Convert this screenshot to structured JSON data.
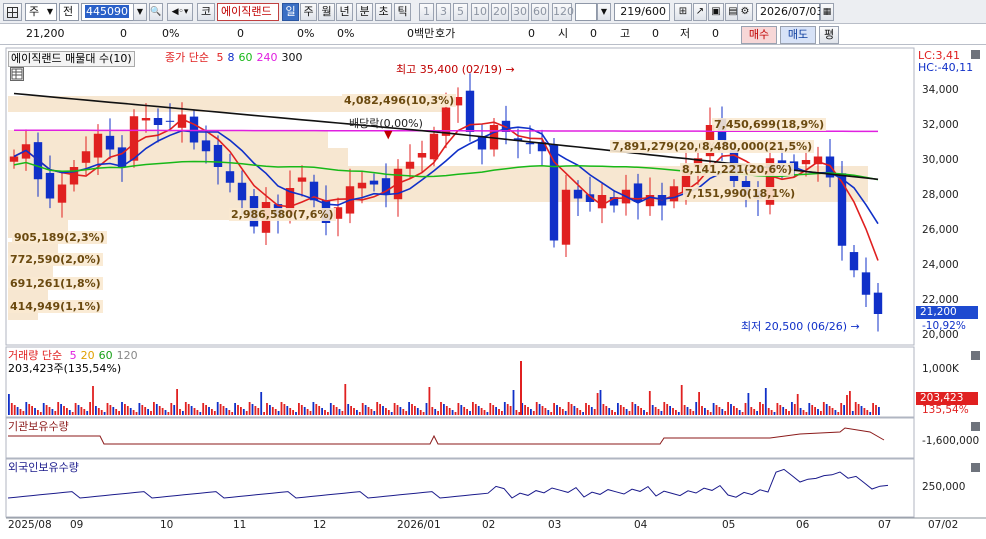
{
  "toolbar": {
    "view_icon": "grid-icon",
    "market": "주",
    "period_mode": "전",
    "code": "445090",
    "sound_icon": "speaker-icon",
    "name_prefix": "코",
    "stock_name": "에이직랜드",
    "periods": [
      "일",
      "주",
      "월",
      "년",
      "분",
      "초",
      "틱"
    ],
    "active_period": "일",
    "nums": [
      "1",
      "3",
      "5",
      "10",
      "20",
      "30",
      "60",
      "120"
    ],
    "count": "219",
    "total": "600",
    "date": "2026/07/03"
  },
  "quote": {
    "price": "21,200",
    "v1": "0",
    "v2": "0",
    "p1": "0%",
    "v3": "0",
    "p2": "0%",
    "v4": "0",
    "p3": "0%",
    "unit_label": "0백만",
    "hoga_label": "호가",
    "hoga": "0",
    "open_label": "시",
    "open": "0",
    "high_label": "고",
    "high": "0",
    "low_label": "저",
    "low": "0",
    "buy": "매수",
    "sell": "매도",
    "avg": "평"
  },
  "price_panel": {
    "title": "에이직랜드 매물대 수(10)",
    "ma_label": "종가 단순",
    "ma_periods": [
      {
        "p": "5",
        "color": "#e02020"
      },
      {
        "p": "8",
        "color": "#1030c8"
      },
      {
        "p": "60",
        "color": "#18b818"
      },
      {
        "p": "240",
        "color": "#e020e0"
      },
      {
        "p": "300",
        "color": "#111111"
      }
    ],
    "lc": "LC:3,41",
    "hc": "HC:-40,11",
    "y_ticks": [
      "34,000",
      "32,000",
      "30,000",
      "28,000",
      "26,000",
      "24,000",
      "22,000",
      "20,000"
    ],
    "current_price": "21,200",
    "current_change": "-10,92%",
    "high_annot": "최고 35,400 (02/19)",
    "low_annot": "최저 20,500 (06/26)",
    "dividend": "배당락(0,00%)",
    "volume_profile_labels": [
      "4,082,496(10,3%)",
      "2,986,580(7,6%)",
      "7,450,699(18,9%)",
      "7,891,279(20,0%)",
      "8,480,000(21,5%)",
      "7,151,990(18,1%)",
      "8,141,221(20,6%)",
      "905,189(2,3%)",
      "772,590(2,0%)",
      "691,261(1,8%)",
      "414,949(1,1%)"
    ]
  },
  "volume_panel": {
    "title": "거래량",
    "ma_label": "단순",
    "ma_periods": [
      {
        "p": "5",
        "color": "#e020e0"
      },
      {
        "p": "20",
        "color": "#e0a000"
      },
      {
        "p": "60",
        "color": "#18a018"
      },
      {
        "p": "120",
        "color": "#888888"
      }
    ],
    "value_text": "203,423주(135,54%)",
    "y_tick": "1,000K",
    "current": "203,423",
    "current_pct": "135,54%"
  },
  "inst_panel": {
    "title": "기관보유수량",
    "y_tick": "-1,600,000"
  },
  "foreign_panel": {
    "title": "외국인보유수량",
    "y_tick": "250,000"
  },
  "x_axis": [
    "2025/08",
    "09",
    "10",
    "11",
    "12",
    "2026/01",
    "02",
    "03",
    "04",
    "05",
    "06",
    "07",
    "07/02"
  ],
  "chart_data": {
    "type": "candlestick",
    "title": "에이직랜드",
    "series": [
      {
        "name": "종가",
        "values": [
          30200,
          30900,
          28900,
          27800,
          28600,
          29600,
          30500,
          31500,
          30600,
          29600,
          32500,
          32400,
          32000,
          32200,
          32600,
          31000,
          30500,
          29600,
          28700,
          27700,
          26200,
          27600,
          26800,
          28400,
          29000,
          27700,
          26400,
          27300,
          28500,
          28700,
          28600,
          28000,
          29500,
          29900,
          30400,
          31500,
          33000,
          33600,
          31600,
          30600,
          32000,
          31600,
          31100,
          30900,
          30500,
          25400,
          28300,
          27800,
          27600,
          28000,
          27400,
          28300,
          27600,
          28000,
          27400,
          28500,
          29700,
          30100,
          32000,
          30800,
          28800,
          28000,
          27800,
          30100,
          29800,
          29400,
          30000,
          30200,
          29000,
          25100,
          23700,
          22300,
          21200
        ]
      }
    ],
    "y_range": [
      20000,
      35000
    ],
    "high": {
      "date": "02/19",
      "value": 35400
    },
    "low": {
      "date": "06/26",
      "value": 20500
    }
  }
}
